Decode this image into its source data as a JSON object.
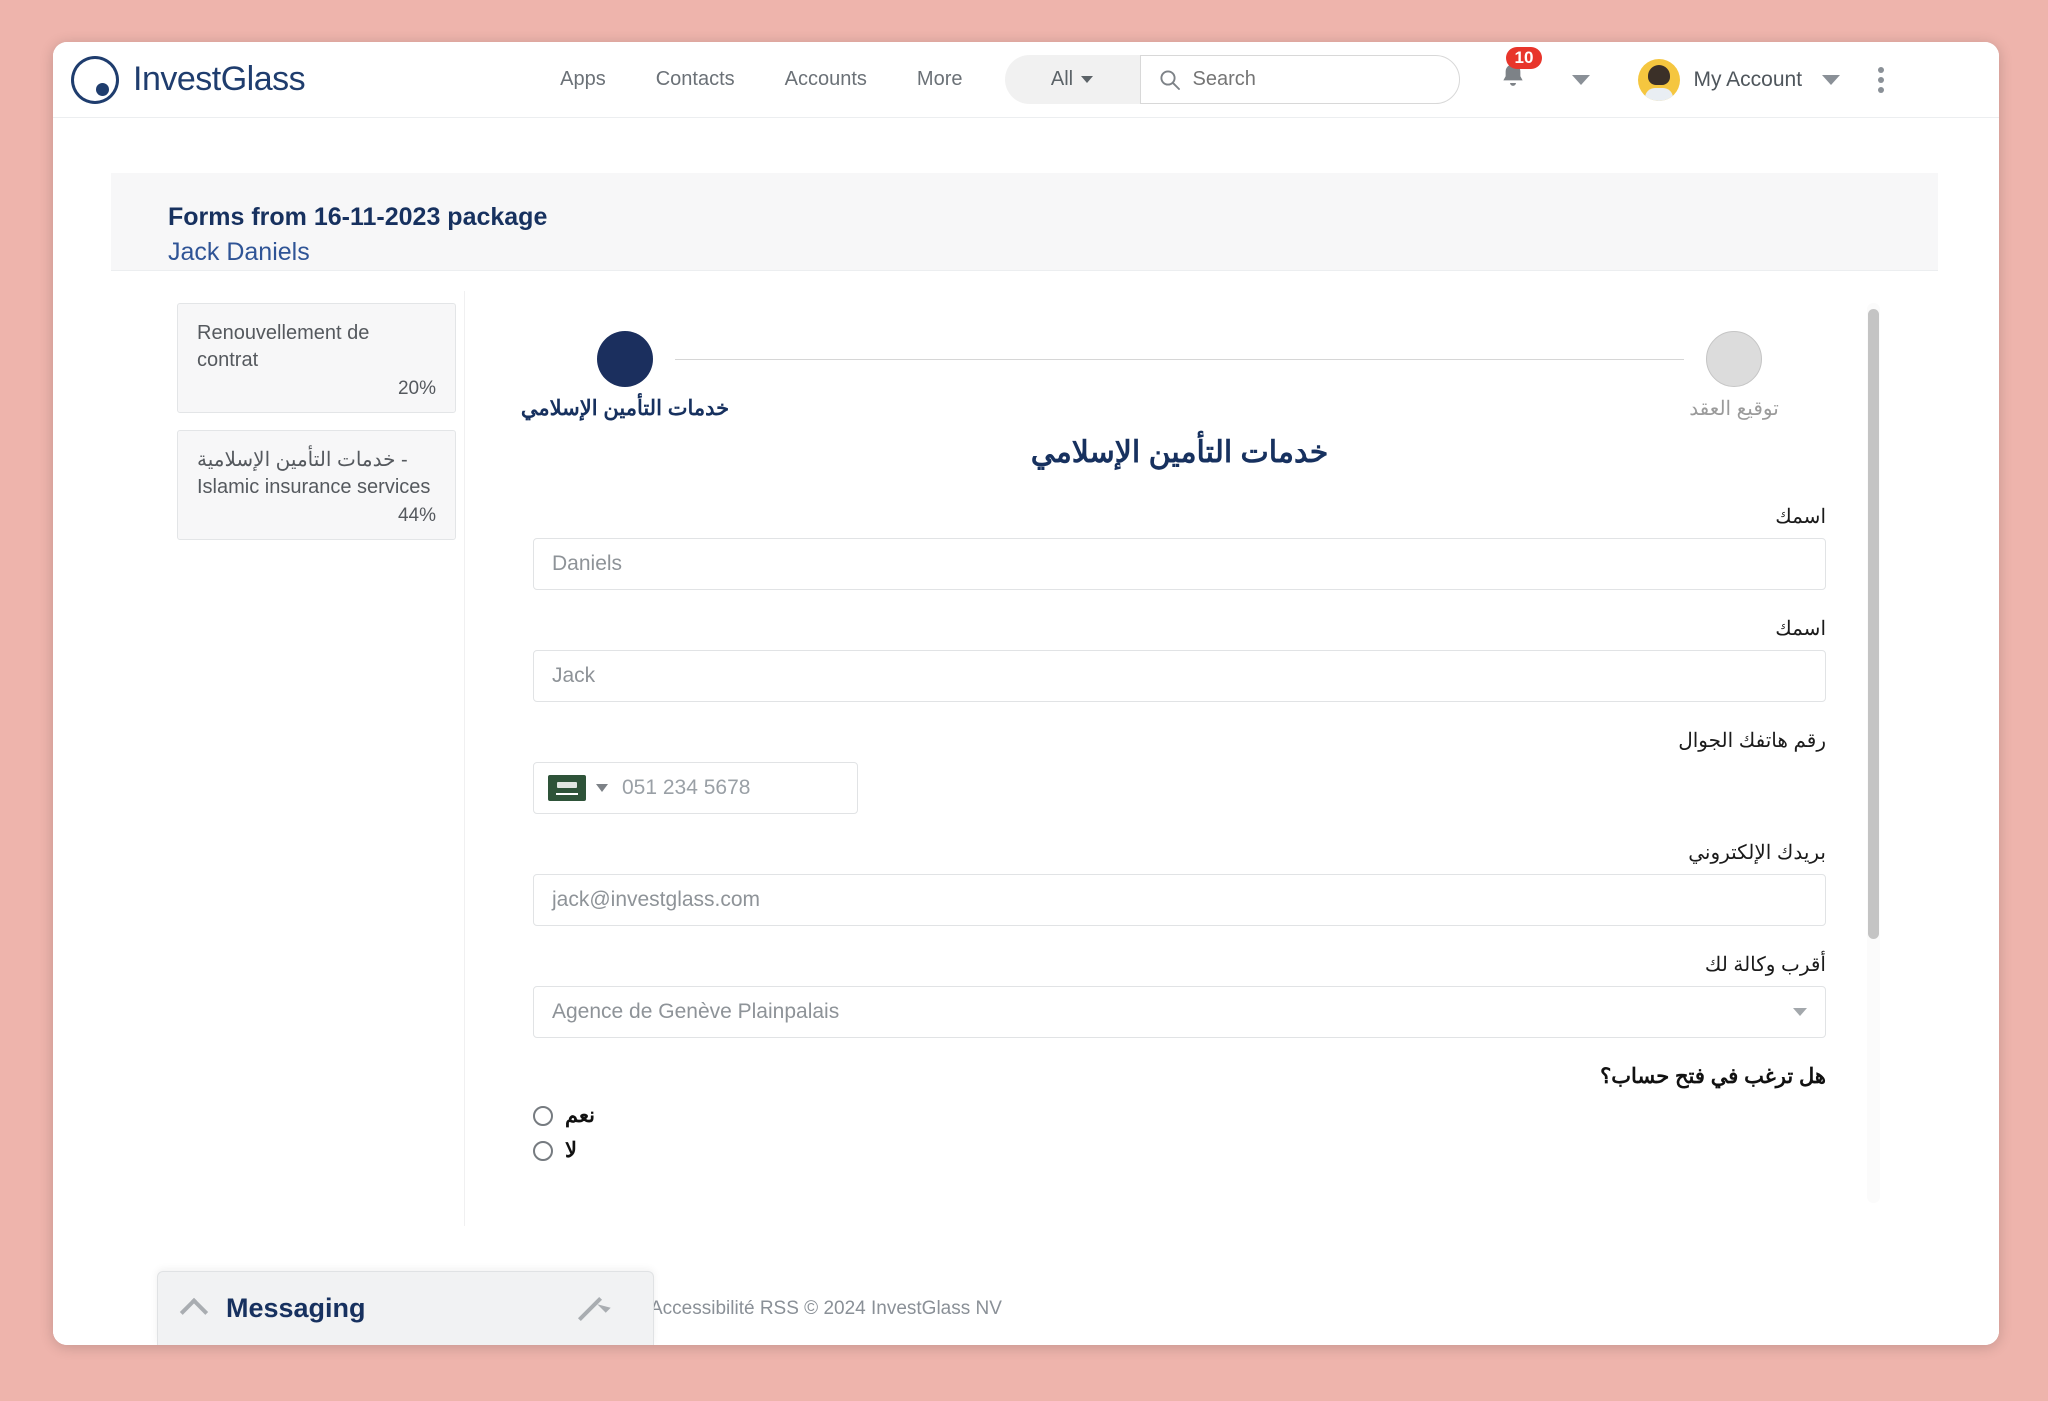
{
  "topnav": {
    "brand": "InvestGlass",
    "links": [
      {
        "label": "Apps"
      },
      {
        "label": "Contacts"
      },
      {
        "label": "Accounts"
      },
      {
        "label": "More"
      }
    ],
    "search_scope": "All",
    "search_placeholder": "Search",
    "search_value": "",
    "notification_count": "10",
    "account_label": "My Account"
  },
  "header": {
    "title": "Forms from 16-11-2023 package",
    "subtitle": "Jack Daniels"
  },
  "sidebar": {
    "items": [
      {
        "label": "Renouvellement de contrat",
        "percent": "20%"
      },
      {
        "label": "خدمات التأمين الإسلامية - Islamic insurance services",
        "percent": "44%"
      }
    ]
  },
  "stepper": {
    "steps": [
      {
        "label": "خدمات التأمين الإسلامي",
        "state": "active"
      },
      {
        "label": "توقيع العقد",
        "state": "inactive"
      }
    ]
  },
  "form": {
    "title": "خدمات التأمين الإسلامي",
    "fields": [
      {
        "label": "اسمك",
        "value": "Daniels",
        "type": "text"
      },
      {
        "label": "اسمك",
        "value": "Jack",
        "type": "text"
      },
      {
        "label": "رقم هاتفك الجوال",
        "value": "051 234 5678",
        "type": "phone",
        "flag": "saudi-arabia-flag"
      },
      {
        "label": "بريدك الإلكتروني",
        "value": "jack@investglass.com",
        "type": "email"
      },
      {
        "label": "أقرب وكالة لك",
        "value": "Agence de Genève Plainpalais",
        "type": "select"
      }
    ],
    "radio_group": {
      "question": "هل ترغب في فتح حساب؟",
      "options": [
        {
          "label": "نعم",
          "selected": false
        },
        {
          "label": "لا",
          "selected": false
        }
      ]
    }
  },
  "messaging": {
    "title": "Messaging"
  },
  "footer": {
    "text": "Accessibilité RSS © 2024 InvestGlass NV"
  },
  "colors": {
    "brand_navy": "#1f3d6e",
    "title_navy": "#17315f",
    "badge_red": "#e8352b",
    "page_bg": "#eeb4ac",
    "step_active": "#1b2f5e",
    "step_inactive": "#dcdcdc"
  }
}
